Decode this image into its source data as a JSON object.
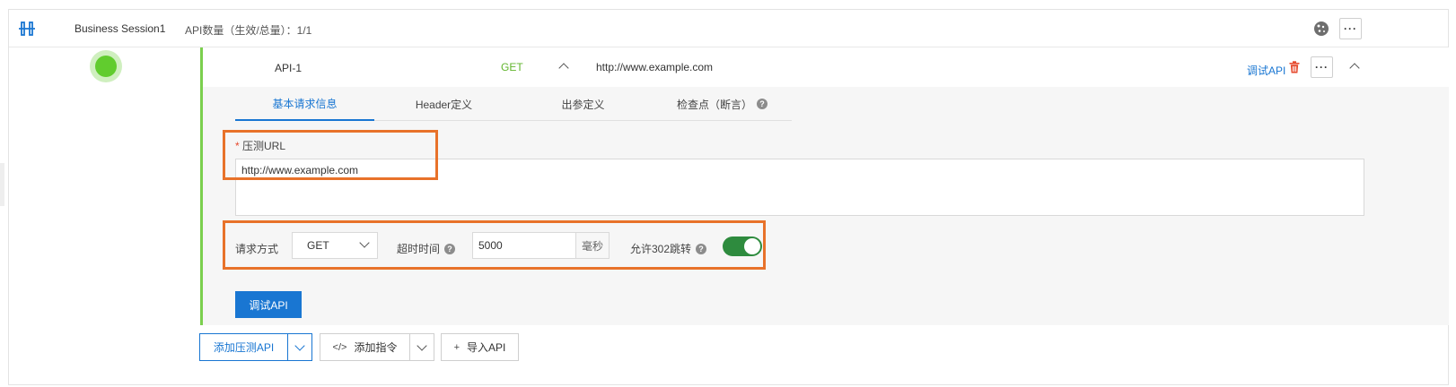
{
  "session": {
    "name": "Business Session1",
    "api_count": "API数量（生效/总量）：1/1"
  },
  "api": {
    "name": "API-1",
    "method": "GET",
    "url": "http://www.example.com",
    "debug_link": "调试API"
  },
  "tabs": [
    {
      "label": "基本请求信息",
      "active": true
    },
    {
      "label": "Header定义",
      "active": false
    },
    {
      "label": "出参定义",
      "active": false
    },
    {
      "label": "检查点（断言）",
      "active": false
    }
  ],
  "form": {
    "url_label": "压测URL",
    "url_value": "http://www.example.com",
    "method_label": "请求方式",
    "method_value": "GET",
    "timeout_label": "超时时间",
    "timeout_value": "5000",
    "timeout_unit": "毫秒",
    "redirect_label": "允许302跳转",
    "redirect_enabled": true,
    "debug_button": "调试API"
  },
  "bottom": {
    "add_api": "添加压测API",
    "add_command": "添加指令",
    "import_api": "导入API"
  },
  "colors": {
    "accent": "#1976d2",
    "success": "#61cc2e",
    "highlight": "#e8722a",
    "toggle_on": "#2e8b3e",
    "danger": "#e6492d"
  }
}
